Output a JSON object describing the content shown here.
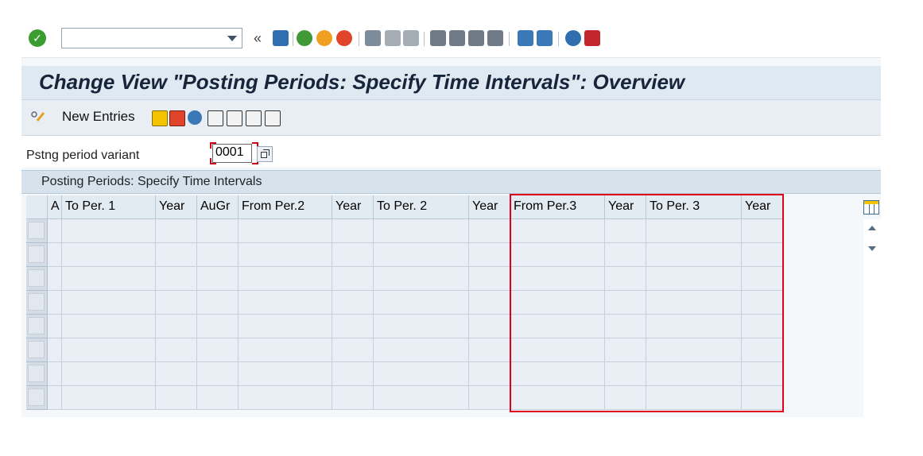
{
  "toolbar": {
    "command_field_value": "",
    "ok_symbol": "✓",
    "double_arrow": "«",
    "icons": [
      "ok-icon",
      "dropdown-icon",
      "save-icon",
      "back-icon",
      "exit-icon",
      "cancel-icon",
      "print-icon",
      "find-icon",
      "find-next-icon",
      "first-page-icon",
      "previous-page-icon",
      "next-page-icon",
      "last-page-icon",
      "create-session-icon",
      "shortcut-icon",
      "help-icon",
      "customize-layout-icon"
    ]
  },
  "title": "Change View \"Posting Periods: Specify Time Intervals\": Overview",
  "app_toolbar": {
    "new_entries_label": "New Entries",
    "icons": [
      "display-change-icon",
      "copy-icon",
      "delete-icon",
      "undo-icon",
      "select-all-icon",
      "select-block-icon",
      "deselect-all-icon",
      "print-list-icon"
    ]
  },
  "form": {
    "variant_label": "Pstng period variant",
    "variant_value": "0001"
  },
  "section_title": "Posting Periods: Specify Time Intervals",
  "table": {
    "headers": [
      "A",
      "To Per. 1",
      "Year",
      "AuGr",
      "From Per.2",
      "Year",
      "To Per. 2",
      "Year",
      "From Per.3",
      "Year",
      "To Per. 3",
      "Year"
    ],
    "row_count": 8
  },
  "colors": {
    "accent": "#3b9d2f",
    "highlight": "#e0001b",
    "title_bg": "#dfe9f2"
  }
}
